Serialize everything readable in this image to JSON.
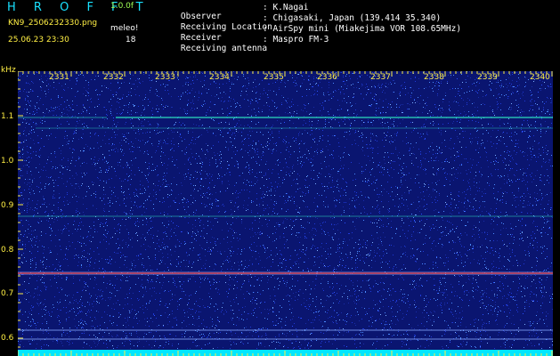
{
  "header": {
    "logo": "H R O F F T",
    "version": "1.0.0f",
    "filename": "KN9_2506232330.png",
    "station_label": "meleo!",
    "datetime": "25.06.23 23:30",
    "count": "18"
  },
  "info": [
    {
      "label": "Observer",
      "value": ": K.Nagai"
    },
    {
      "label": "Receiving Location",
      "value": ": Chigasaki, Japan (139.414 35.340)"
    },
    {
      "label": "Receiver",
      "value": ": AirSpy mini (Miakejima VOR 108.65MHz)"
    },
    {
      "label": "Receiving antenna",
      "value": ": Maspro FM-3"
    }
  ],
  "spectrogram": {
    "y_unit": "kHz",
    "y_ticks": [
      "1.1",
      "1.0",
      "0.9",
      "0.8",
      "0.7",
      "0.6"
    ],
    "x_ticks": [
      "2331",
      "2332",
      "2333",
      "2334",
      "2335",
      "2336",
      "2337",
      "2338",
      "2339",
      "2340"
    ],
    "colors": {
      "background": "#0a1570",
      "noise": "#2a50ff",
      "signal": "#33ffcc",
      "strong": "#ff4040",
      "baseline": "#00e6ff"
    }
  }
}
